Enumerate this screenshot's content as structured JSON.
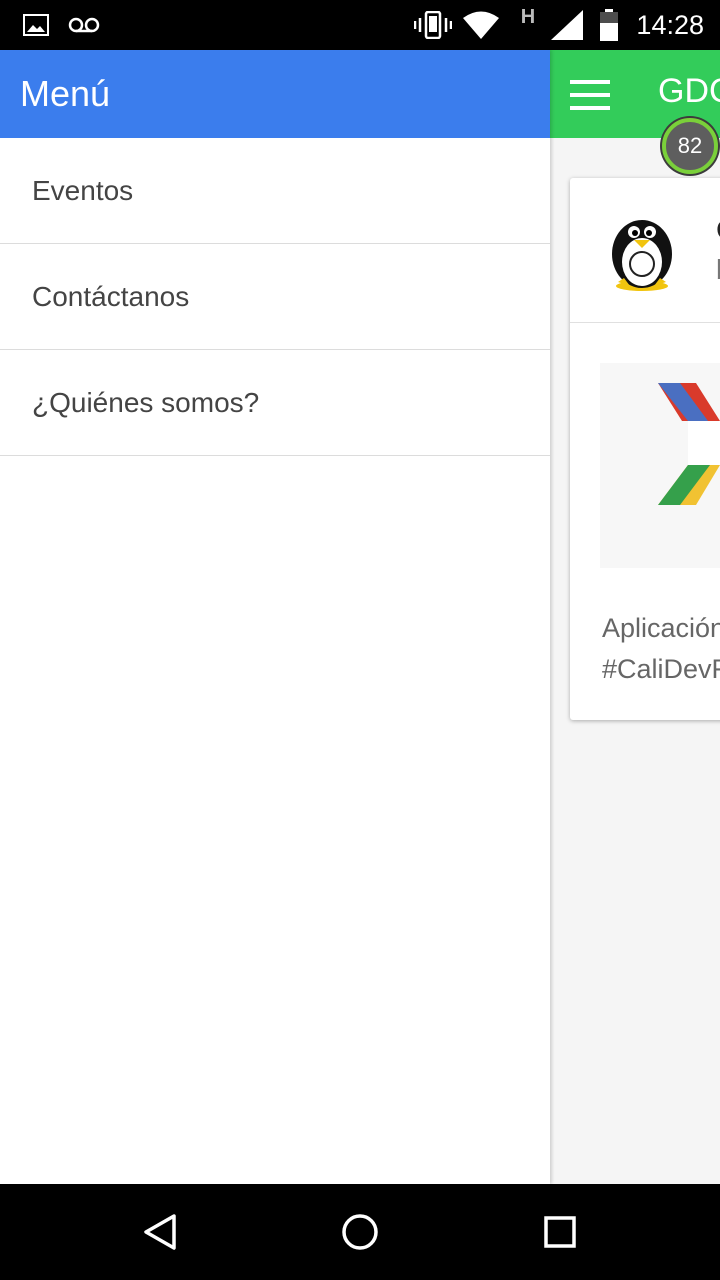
{
  "status_bar": {
    "time": "14:28",
    "network_label": "H",
    "icons": [
      "image-icon",
      "voicemail-icon",
      "vibrate-icon",
      "wifi-icon",
      "signal-icon",
      "battery-icon"
    ]
  },
  "drawer": {
    "title": "Menú",
    "color": "#3b7ded",
    "items": [
      {
        "label": "Eventos"
      },
      {
        "label": "Contáctanos"
      },
      {
        "label": "¿Quiénes somos?"
      }
    ]
  },
  "main": {
    "app_bar_color": "#33cc5a",
    "title": "GDG",
    "score_badge": "82",
    "card": {
      "title": "C",
      "subtitle": "b",
      "text_line1": "Aplicación",
      "text_line2": "#CaliDevF"
    }
  },
  "nav_bar": {
    "buttons": [
      "back-icon",
      "home-icon",
      "recents-icon"
    ]
  }
}
